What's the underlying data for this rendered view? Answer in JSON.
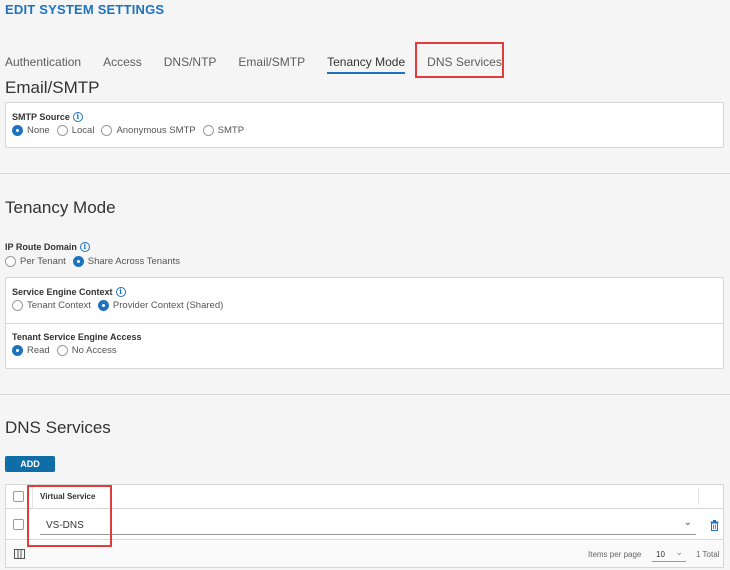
{
  "page": {
    "title": "EDIT SYSTEM SETTINGS"
  },
  "tabs": [
    {
      "label": "Authentication"
    },
    {
      "label": "Access"
    },
    {
      "label": "DNS/NTP"
    },
    {
      "label": "Email/SMTP"
    },
    {
      "label": "Tenancy Mode"
    },
    {
      "label": "DNS Services"
    }
  ],
  "email_smtp": {
    "title": "Email/SMTP",
    "smtp_source": {
      "label": "SMTP Source",
      "options": [
        "None",
        "Local",
        "Anonymous SMTP",
        "SMTP"
      ],
      "selected": "None"
    }
  },
  "tenancy": {
    "title": "Tenancy Mode",
    "ip_route_domain": {
      "label": "IP Route Domain",
      "options": [
        "Per Tenant",
        "Share Across Tenants"
      ],
      "selected": "Share Across Tenants"
    },
    "se_context": {
      "label": "Service Engine Context",
      "options": [
        "Tenant Context",
        "Provider Context (Shared)"
      ],
      "selected": "Provider Context (Shared)"
    },
    "tenant_se_access": {
      "label": "Tenant Service Engine Access",
      "options": [
        "Read",
        "No Access"
      ],
      "selected": "Read"
    }
  },
  "dns_services": {
    "title": "DNS Services",
    "add_label": "ADD",
    "column_header": "Virtual Service",
    "rows": [
      {
        "value": "VS-DNS"
      }
    ],
    "footer": {
      "items_per_page_label": "Items per page",
      "items_per_page": "10",
      "total": "1 Total"
    }
  },
  "icons": {
    "info": "info-icon",
    "dropdown": "chevron-down-icon",
    "delete": "trash-icon",
    "columns": "column-toggle-icon"
  },
  "colors": {
    "accent": "#1e73be",
    "button": "#0f6ea8",
    "highlight": "#e03c3c"
  }
}
